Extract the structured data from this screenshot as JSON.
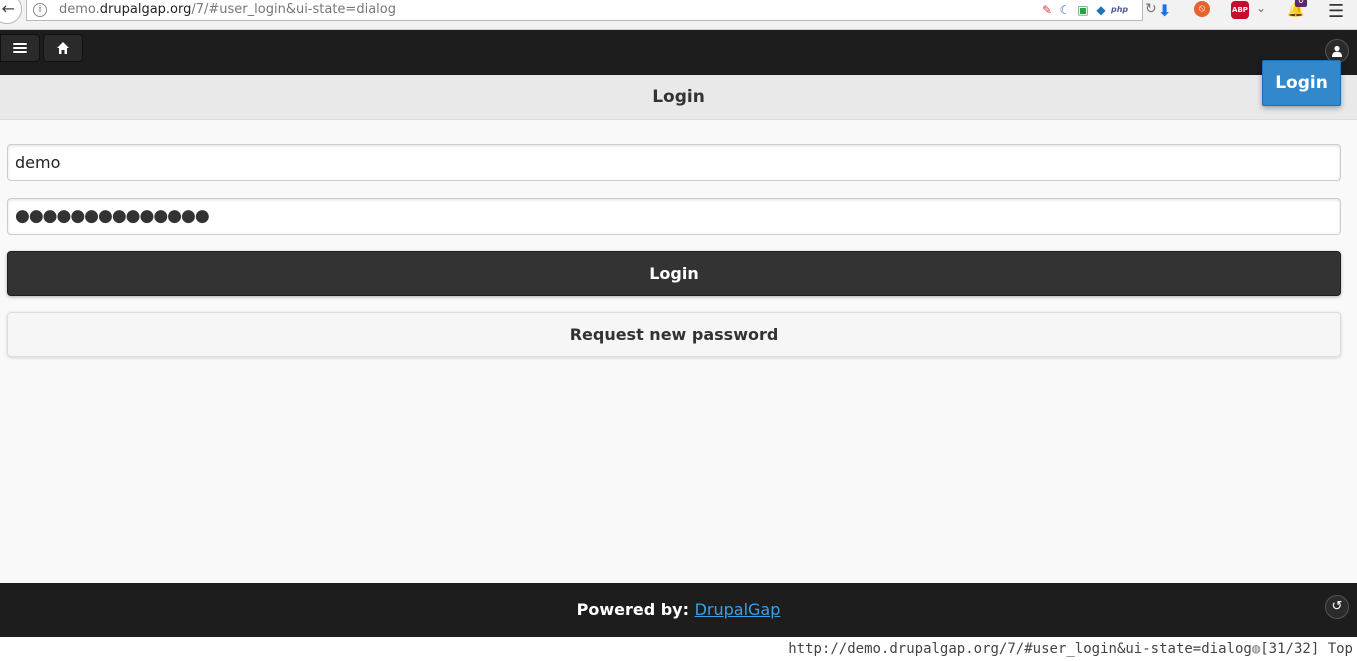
{
  "browser": {
    "url_prefix": "demo.",
    "url_host": "drupalgap.org",
    "url_path": "/7/#user_login&ui-state=dialog",
    "back_glyph": "←",
    "info_glyph": "i",
    "reload_glyph": "↻",
    "download_glyph": "⬇",
    "addon_glyph": "⦸",
    "abp_label": "ABP",
    "dropdown_glyph": "⌄",
    "notif_glyph": "🔔",
    "notif_count": "0",
    "menu_glyph": "☰",
    "extensions": [
      {
        "name": "feather-extension-icon",
        "glyph": "✎",
        "color": "#d23b3b"
      },
      {
        "name": "moon-extension-icon",
        "glyph": "☾",
        "color": "#3a6fc4"
      },
      {
        "name": "screen-extension-icon",
        "glyph": "▣",
        "color": "#2f9e44"
      },
      {
        "name": "drupal-extension-icon",
        "glyph": "◆",
        "color": "#1b75bb"
      },
      {
        "name": "php-extension-icon",
        "glyph": "php",
        "color": "#4f5b93"
      }
    ]
  },
  "header": {
    "home_glyph": "⌂",
    "user_glyph": "👤"
  },
  "page": {
    "title": "Login"
  },
  "popup": {
    "login_label": "Login"
  },
  "form": {
    "username_value": "demo",
    "password_mask": "●●●●●●●●●●●●●●",
    "login_button_label": "Login",
    "request_password_label": "Request new password"
  },
  "footer": {
    "powered_by_label": "Powered by:",
    "link_text": "DrupalGap",
    "back_glyph": "↺"
  },
  "status": {
    "url": "http://demo.drupalgap.org/7/#user_login&ui-state=dialog",
    "globe_glyph": "◍",
    "position": "[31/32]",
    "scroll": "Top"
  }
}
